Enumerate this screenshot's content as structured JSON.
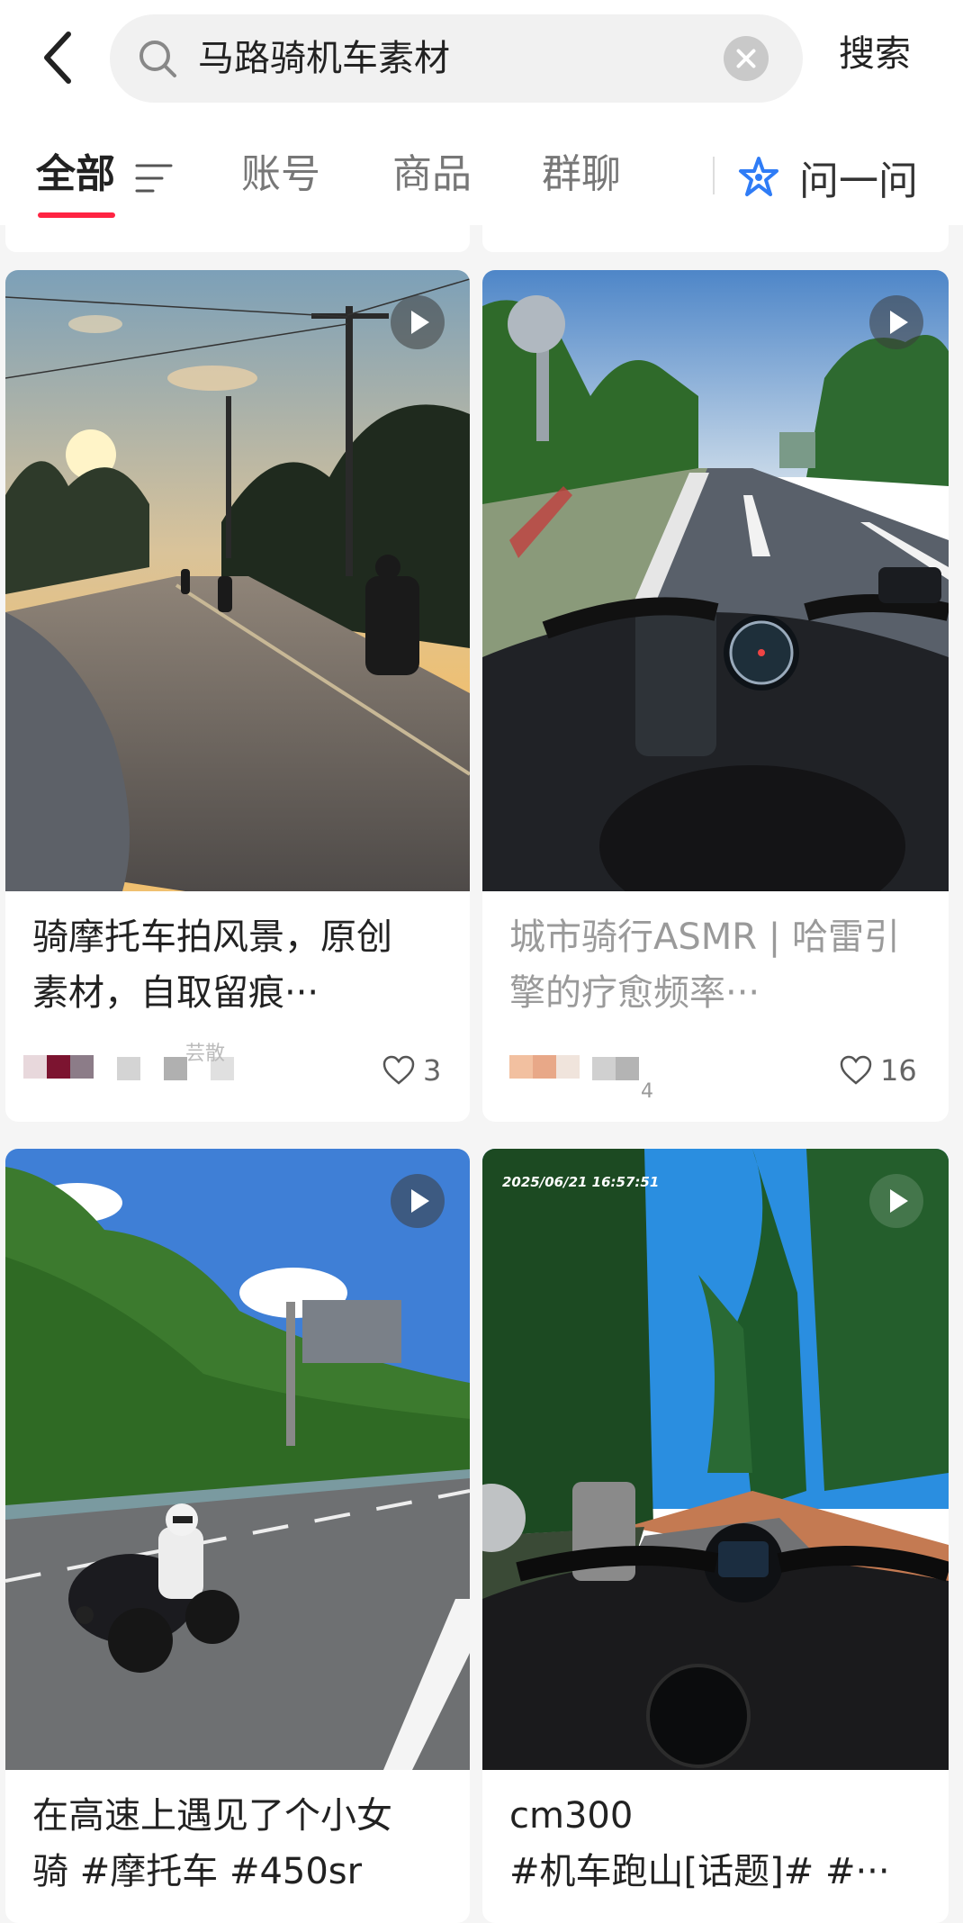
{
  "header": {
    "search_query": "马路骑机车素材",
    "search_button": "搜索"
  },
  "tabs": [
    {
      "label": "全部",
      "active": true
    },
    {
      "label": "账号",
      "active": false
    },
    {
      "label": "商品",
      "active": false
    },
    {
      "label": "群聊",
      "active": false
    }
  ],
  "ask_button": "问一问",
  "colors": {
    "accent": "#ff2442",
    "ask_icon": "#2f7cf6"
  },
  "feed": {
    "cards": [
      {
        "title_line1": "骑摩托车拍风景，原创",
        "title_line2": "素材，自取留痕···",
        "author": "芸散",
        "likes": "3",
        "video": true
      },
      {
        "title_line1": "城市骑行ASMR | 哈雷引",
        "title_line2": "擎的疗愈频率···",
        "author": "4",
        "likes": "16",
        "video": true
      },
      {
        "title_line1": "在高速上遇见了个小女",
        "title_line2": "骑 #摩托车 #450sr",
        "video": true
      },
      {
        "title_line1": "cm300",
        "title_line2": "#机车跑山[话题]# #···",
        "timestamp": "2025/06/21 16:57:51",
        "video": true
      }
    ]
  }
}
